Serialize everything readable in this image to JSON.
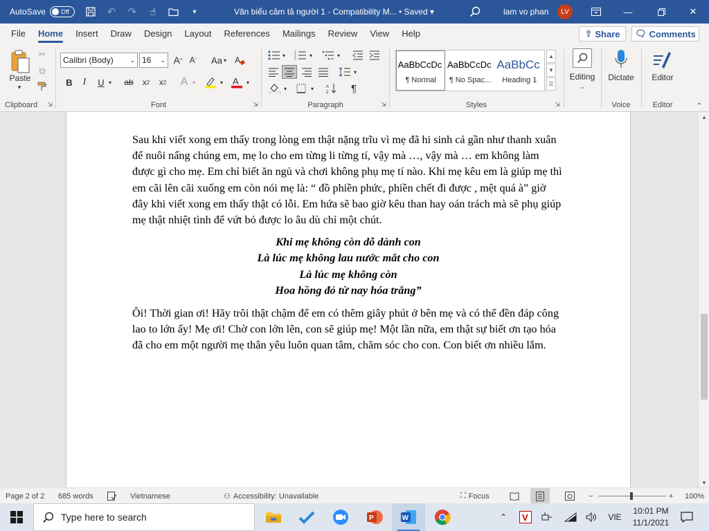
{
  "titlebar": {
    "autosave_label": "AutoSave",
    "autosave_state": "Off",
    "doc_title": "Văn biểu cảm tả người 1  -  Compatibility M...  •  Saved  ▾",
    "user_name": "lam vo phan",
    "user_initials": "LV"
  },
  "menu": {
    "tabs": [
      "File",
      "Home",
      "Insert",
      "Draw",
      "Design",
      "Layout",
      "References",
      "Mailings",
      "Review",
      "View",
      "Help"
    ],
    "active": "Home",
    "share": "Share",
    "comments": "Comments"
  },
  "ribbon": {
    "clipboard": {
      "paste": "Paste",
      "label": "Clipboard"
    },
    "font": {
      "name": "Calibri (Body)",
      "size": "16",
      "change_case": "Aa",
      "label": "Font"
    },
    "paragraph": {
      "label": "Paragraph"
    },
    "styles": {
      "label": "Styles",
      "items": [
        {
          "preview": "AaBbCcDc",
          "name": "¶ Normal"
        },
        {
          "preview": "AaBbCcDc",
          "name": "¶ No Spac..."
        },
        {
          "preview": "AaBbCc",
          "name": "Heading 1"
        }
      ]
    },
    "editing": {
      "label": "Editing"
    },
    "voice": {
      "dictate": "Dictate",
      "label": "Voice"
    },
    "editor": {
      "editor": "Editor",
      "label": "Editor"
    }
  },
  "document": {
    "para1": "Sau khi viết xong em thấy trong lòng em thật nặng trĩu vì mẹ đã hi sinh cả gần như thanh xuân để nuôi nấng chúng em, mẹ lo cho em từng li từng tí, vậy mà …, vậy mà … em không làm được gì cho mẹ. Em chỉ biết ăn ngủ và chơi không phụ mẹ tí nào. Khi mẹ kêu em là giúp mẹ thì em cãi lên cãi xuống em còn nói mẹ là: “ đồ phiền phức, phiền chết đi được , mệt quá à” giờ đây khi viết xong em thấy thật có lỗi. Em hứa sẽ bao giờ kêu than  hay oán trách mà sẽ phụ giúp mẹ thật nhiệt tình để vứt bỏ được lo âu dù chỉ một chút.",
    "poem": [
      "Khi mẹ không còn dỗ dành con",
      "Là lúc mẹ không lau nước mắt cho con",
      "Là lúc mẹ không còn",
      "Hoa hồng đỏ từ nay hóa trắng”"
    ],
    "para2": "Ôi! Thời gian ơi! Hãy trôi thật chậm để em có thêm giây phút ở bên mẹ và có thể đền đáp công lao to lớn ấy! Mẹ ơi! Chờ con lớn lên, con sẽ giúp mẹ! Một lần nữa, em thật sự biết ơn tạo hóa đã cho em một người mẹ thân yêu luôn quan tâm, chăm sóc cho con. Con biết ơn nhiều lắm."
  },
  "statusbar": {
    "page": "Page 2 of 2",
    "words": "685 words",
    "language": "Vietnamese",
    "accessibility": "Accessibility: Unavailable",
    "focus": "Focus",
    "zoom": "100%"
  },
  "taskbar": {
    "search_placeholder": "Type here to search",
    "lang": "VIE",
    "time": "10:01 PM",
    "date": "11/1/2021"
  },
  "colors": {
    "title_bar": "#2b579a",
    "avatar": "#c43e1c",
    "ribbon": "#f3f2f1"
  }
}
